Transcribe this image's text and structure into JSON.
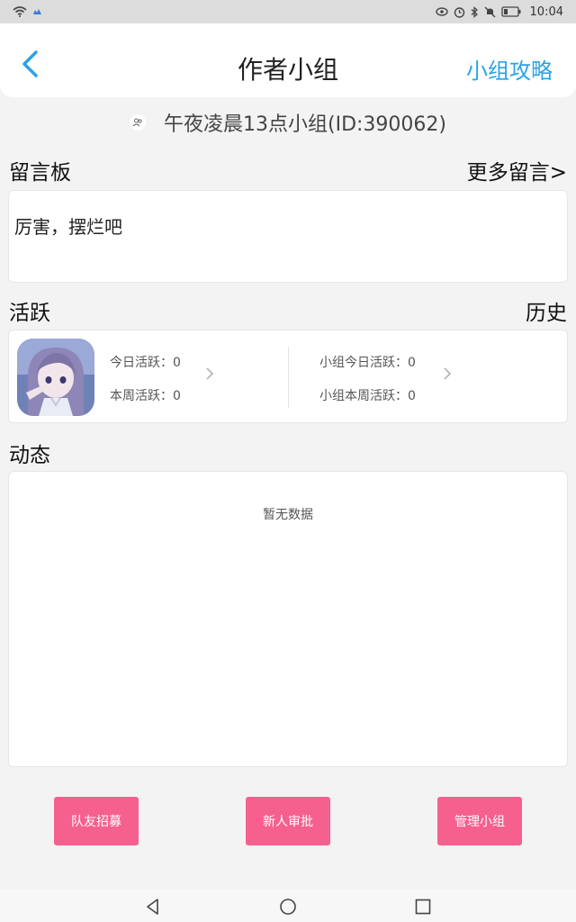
{
  "status_bar": {
    "time": "10:04",
    "icons": [
      "wifi-icon",
      "cloud-icon",
      "eye-icon",
      "alarm-icon",
      "bluetooth-icon",
      "mute-icon",
      "battery-icon"
    ]
  },
  "header": {
    "title": "作者小组",
    "right_link": "小组攻略"
  },
  "group": {
    "name": "午夜凌晨13点小组(ID:390062)"
  },
  "message_board": {
    "title": "留言板",
    "more": "更多留言>",
    "latest_message": "厉害，摆烂吧"
  },
  "activity": {
    "title": "活跃",
    "history": "历史",
    "today_label": "今日活跃：0",
    "week_label": "本周活跃：0",
    "group_today_label": "小组今日活跃：0",
    "group_week_label": "小组本周活跃：0"
  },
  "feed": {
    "title": "动态",
    "empty": "暂无数据"
  },
  "actions": {
    "recruit": "队友招募",
    "approve": "新人审批",
    "manage": "管理小组"
  },
  "colors": {
    "accent_blue": "#2ba3e6",
    "button_pink": "#f6608e",
    "background": "#f3f3f3"
  }
}
